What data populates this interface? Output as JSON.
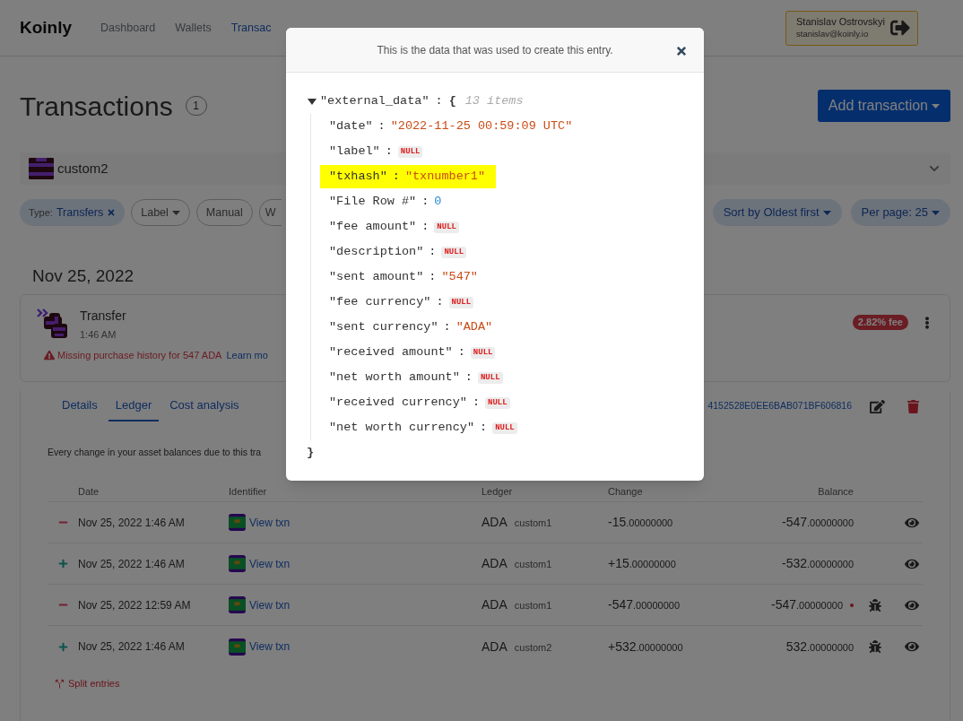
{
  "header": {
    "logo": "Koinly",
    "nav": [
      {
        "label": "Dashboard",
        "selected": false
      },
      {
        "label": "Wallets",
        "selected": false
      },
      {
        "label": "Transac",
        "selected": true
      }
    ],
    "user": {
      "name": "Stanislav Ostrovskyi",
      "email": "stanislav@koinly.io"
    }
  },
  "page": {
    "title": "Transactions",
    "count": "1",
    "add_button": "Add transaction",
    "wallet": "custom2",
    "filters": [
      {
        "kind": "type",
        "prefix": "Type:",
        "label": "Transfers"
      },
      {
        "kind": "dropdown",
        "label": "Label"
      },
      {
        "kind": "plain",
        "label": "Manual"
      },
      {
        "kind": "cut",
        "label": "W"
      }
    ],
    "sort": "Sort by Oldest first",
    "per_page": "Per page: 25"
  },
  "day": "Nov 25, 2022",
  "transaction": {
    "type": "Transfer",
    "time": "1:46 AM",
    "warning": "Missing purchase history for 547 ADA",
    "warning_link": "Learn mo",
    "fee_badge": "2.82% fee"
  },
  "detail": {
    "tabs": [
      {
        "label": "Details",
        "selected": false
      },
      {
        "label": "Ledger",
        "selected": true
      },
      {
        "label": "Cost analysis",
        "selected": false
      }
    ],
    "hash": "4152528E0EE6BAB071BF606816",
    "description": "Every change in your asset balances due to this tra",
    "columns": [
      "Date",
      "Identifier",
      "Ledger",
      "Change",
      "Balance"
    ],
    "rows": [
      {
        "kind": "out",
        "date": "Nov 25, 2022 1:46 AM",
        "link": "View txn",
        "asset": "ADA",
        "wallet": "custom1",
        "change": "-15",
        "change_decimals": ".00000000",
        "balance": "-547",
        "balance_decimals": ".00000000",
        "flag": false,
        "bug": false
      },
      {
        "kind": "in",
        "date": "Nov 25, 2022 1:46 AM",
        "link": "View txn",
        "asset": "ADA",
        "wallet": "custom1",
        "change": "+15",
        "change_decimals": ".00000000",
        "balance": "-532",
        "balance_decimals": ".00000000",
        "flag": false,
        "bug": false
      },
      {
        "kind": "out",
        "date": "Nov 25, 2022 12:59 AM",
        "link": "View txn",
        "asset": "ADA",
        "wallet": "custom1",
        "change": "-547",
        "change_decimals": ".00000000",
        "balance": "-547",
        "balance_decimals": ".00000000",
        "flag": true,
        "bug": true
      },
      {
        "kind": "in",
        "date": "Nov 25, 2022 1:46 AM",
        "link": "View txn",
        "asset": "ADA",
        "wallet": "custom2",
        "change": "+532",
        "change_decimals": ".00000000",
        "balance": "532",
        "balance_decimals": ".00000000",
        "flag": false,
        "bug": true
      }
    ],
    "split": "Split entries"
  },
  "modal": {
    "title": "This is the data that was used to create this entry.",
    "root_key": "\"external_data\"",
    "separator": ":",
    "open_brace": "{",
    "close_brace": "}",
    "count": "13 items",
    "expanded": true,
    "entries": [
      {
        "key": "\"date\"",
        "value": "\"2022-11-25 00:59:09 UTC\"",
        "kind": "string",
        "highlighted": false
      },
      {
        "key": "\"label\"",
        "value": "NULL",
        "kind": "null",
        "highlighted": false
      },
      {
        "key": "\"txhash\"",
        "value": "\"txnumber1\"",
        "kind": "string",
        "highlighted": true
      },
      {
        "key": "\"File Row #\"",
        "value": "0",
        "kind": "number",
        "highlighted": false
      },
      {
        "key": "\"fee amount\"",
        "value": "NULL",
        "kind": "null",
        "highlighted": false
      },
      {
        "key": "\"description\"",
        "value": "NULL",
        "kind": "null",
        "highlighted": false
      },
      {
        "key": "\"sent amount\"",
        "value": "\"547\"",
        "kind": "string",
        "highlighted": false
      },
      {
        "key": "\"fee currency\"",
        "value": "NULL",
        "kind": "null",
        "highlighted": false
      },
      {
        "key": "\"sent currency\"",
        "value": "\"ADA\"",
        "kind": "string",
        "highlighted": false
      },
      {
        "key": "\"received amount\"",
        "value": "NULL",
        "kind": "null",
        "highlighted": false
      },
      {
        "key": "\"net worth amount\"",
        "value": "NULL",
        "kind": "null",
        "highlighted": false
      },
      {
        "key": "\"received currency\"",
        "value": "NULL",
        "kind": "null",
        "highlighted": false
      },
      {
        "key": "\"net worth currency\"",
        "value": "NULL",
        "kind": "null",
        "highlighted": false
      }
    ]
  }
}
